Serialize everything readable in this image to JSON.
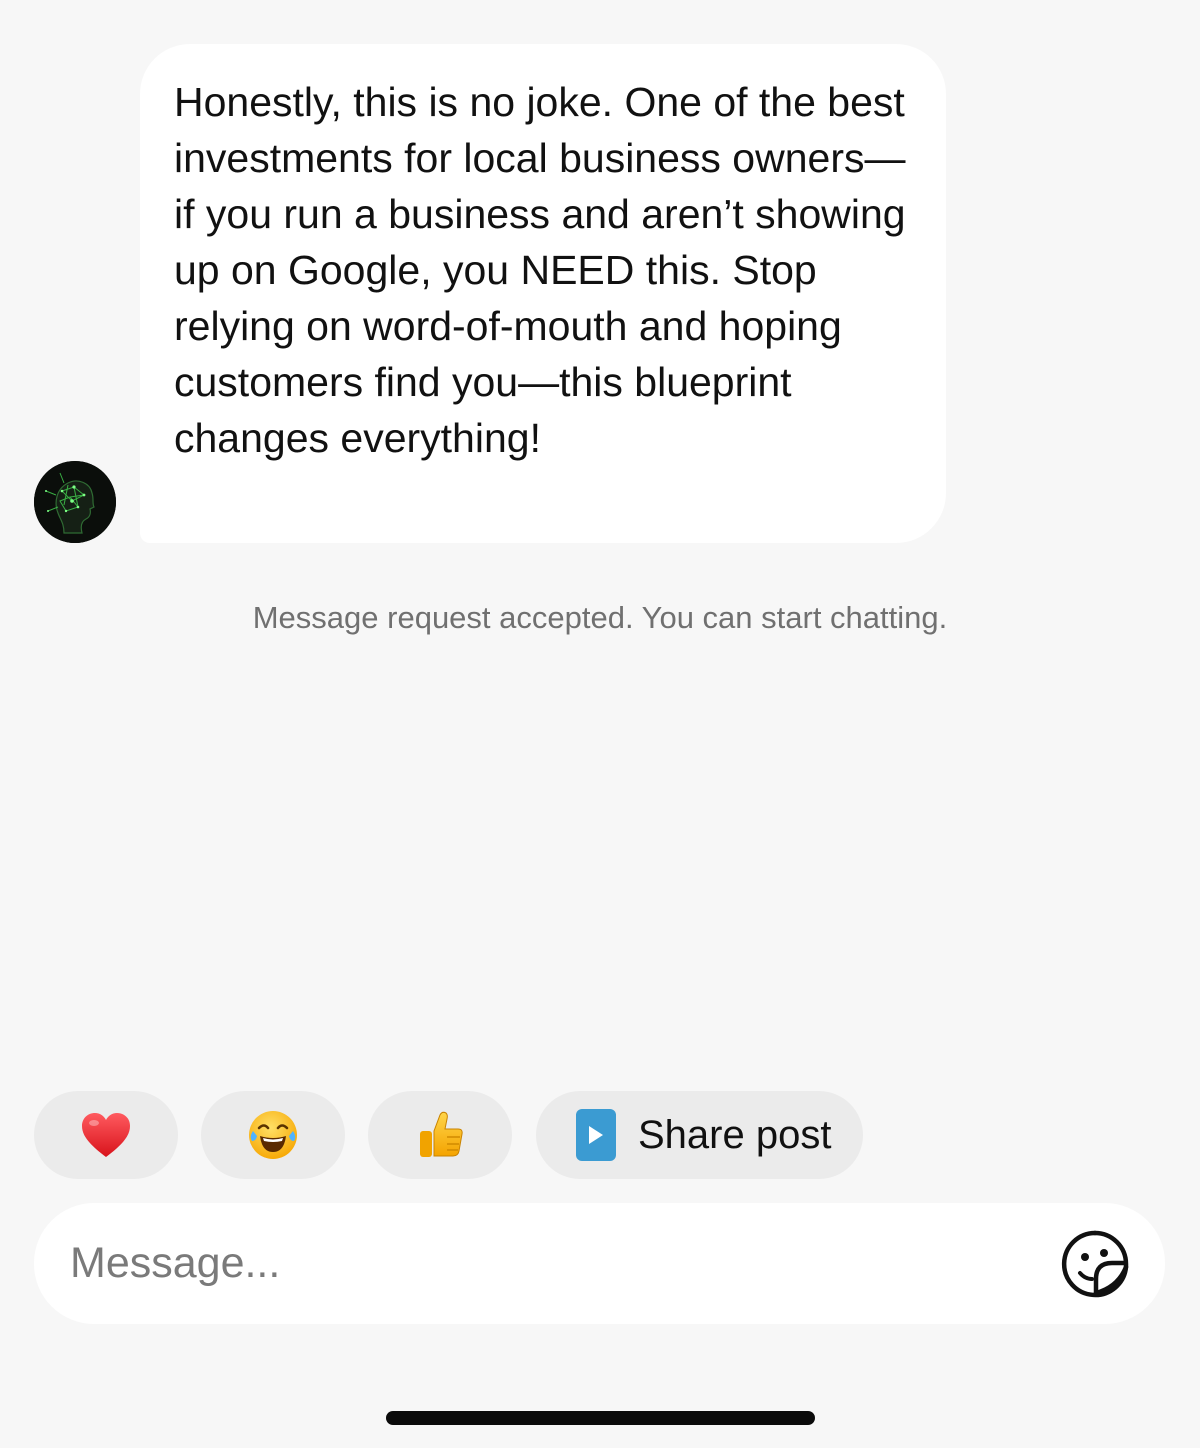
{
  "conversation": {
    "incoming_message": {
      "text": "Honestly, this is no joke. One of the best investments for local business owners—if you run a business and aren’t showing up on Google, you NEED this. Stop relying on word-of-mouth and hoping customers find you—this blueprint changes everything!",
      "avatar_icon": "green-head-silhouette-avatar"
    },
    "system_note": "Message request accepted. You can start chatting."
  },
  "quick_replies": {
    "heart_emoji": "❤️",
    "laugh_emoji": "😂",
    "thumbs_up_emoji": "👍",
    "share_post_label": "Share post",
    "share_post_icon": "play-icon"
  },
  "composer": {
    "placeholder": "Message...",
    "sticker_icon": "sticker-icon"
  },
  "colors": {
    "background": "#f7f7f7",
    "bubble": "#ffffff",
    "chip": "#ebebeb",
    "share_icon": "#3b9bd2",
    "system_text": "#707070"
  }
}
